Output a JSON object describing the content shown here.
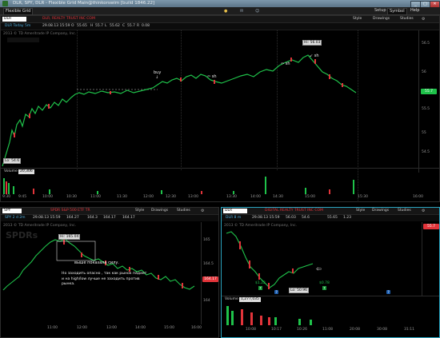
{
  "window": {
    "title": "DLR, SPY, DLR - Flexible Grid Main@thinkorswim [build 1846.22]",
    "tabs_label": "Flexible Grid",
    "top_buttons": [
      "Setup",
      "Symbol",
      "Help"
    ]
  },
  "menu_icons": [
    "bell-icon",
    "mail-icon",
    "users-icon"
  ],
  "pane_main": {
    "symbol": "DLR",
    "quote_bar": "DLR, REALTY TRUST INC COM",
    "sub_label": "DLR Today 5m",
    "date_time": "29.08.13 15:59",
    "fields": {
      "O": "O",
      "o_val": "55.65",
      "H": "H",
      "h_val": "55.7",
      "L": "L",
      "l_val": "55.62",
      "C": "C",
      "c_val": "55.7",
      "R": "R",
      "r_val": "0.08"
    },
    "copyright": "2013 © TD Ameritrade IP Company, Inc.",
    "toolbar": {
      "style": "Style",
      "drawings": "Drawings",
      "studies": "Studies"
    },
    "price_tag": "55.7",
    "y_ticks": [
      "56.5",
      "56",
      "55.5",
      "55",
      "54.5"
    ],
    "labels": {
      "hi": "Hi: 56.03",
      "lo": "Lo: 54.6"
    },
    "annotations": {
      "buy": "buy",
      "sh1": "sh",
      "sh2": "sh",
      "sh3": "sh"
    },
    "volume_label": "Volume",
    "volume_value": "20,306",
    "x_ticks": [
      "9:30",
      "9:45",
      "10:00",
      "10:30",
      "11:00",
      "11:30",
      "12:00",
      "12:30",
      "13:00",
      "13:30",
      "14:00",
      "14:30",
      "15:00",
      "15:30",
      "16:00"
    ]
  },
  "pane_spy": {
    "symbol": "SPY",
    "quote_bar": "SPDR S&P 500 ETF TR",
    "sub_label": "SPY 2 d 2m",
    "date_time": "29.08.13 15:59",
    "fields": {
      "o_val": "164.27",
      "h_val": "164.3",
      "l_val": "164.17",
      "c_val": "164.17"
    },
    "copyright": "2013 © TD Ameritrade IP Company, Inc.",
    "toolbar": {
      "style": "Style",
      "drawings": "Drawings",
      "studies": "Studies"
    },
    "price_tag": "164.17",
    "hi_label": "Hi: 165.04",
    "y_ticks": [
      "165",
      "164.5",
      "164"
    ],
    "note_top": "выше показала силу.",
    "note_bottom": "Но заходить опасно , так как рынок падает и на high/low лучше не заходить против рынка.",
    "x_ticks": [
      "11:00",
      "12:00",
      "13:00",
      "14:00",
      "15:00",
      "16:00"
    ]
  },
  "pane_dlr2": {
    "symbol": "DLR",
    "quote_bar": "DIGITAL REALTY TRUST INC COM",
    "sub_label": "DLR 8 m",
    "date_time": "29.08.13 15:59",
    "fields": {
      "h_val": "56.03",
      "l_val": "54.6",
      "c_val": "55.65",
      "r_val": "1.23"
    },
    "copyright": "2013 © TD Ameritrade IP Company, Inc.",
    "toolbar": {
      "style": "Style",
      "drawings": "Drawings",
      "studies": "Studies"
    },
    "price_tag": "55.7",
    "lo_label": "Lo: 50.96",
    "sig_left": "$1.22",
    "sig_right": "$0.78",
    "volume_label": "Volume",
    "volume_value": "1,277,035",
    "x_ticks": [
      "10:08",
      "10:17",
      "10:26",
      "11:08",
      "20:08",
      "30:08",
      "31:11"
    ]
  },
  "colors": {
    "up": "#1fc24a",
    "down": "#e2343a",
    "accent": "#2aa4c0"
  }
}
